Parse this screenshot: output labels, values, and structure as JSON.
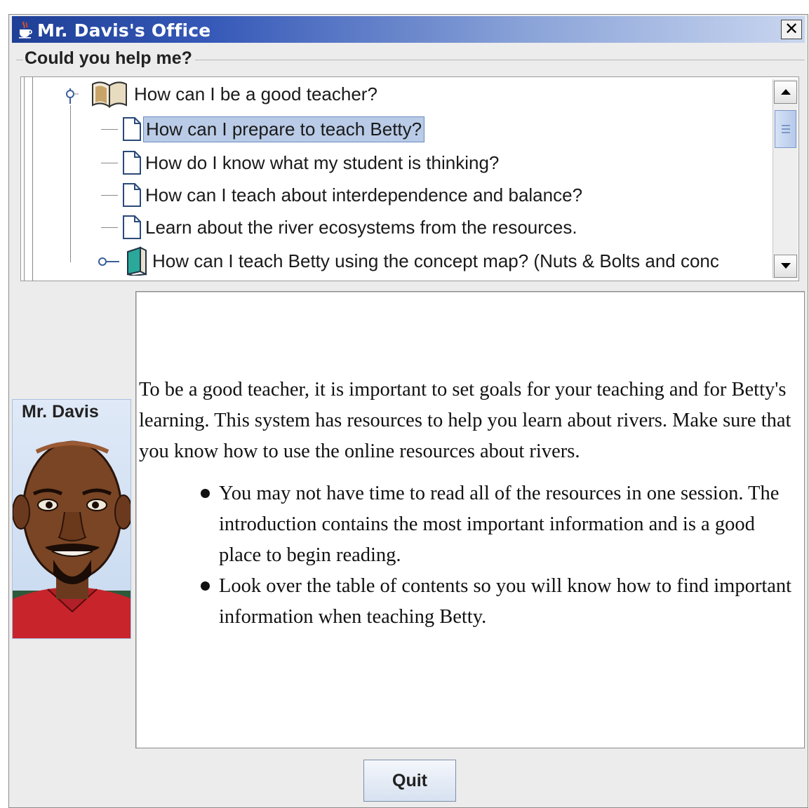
{
  "window": {
    "title": "Mr. Davis's Office",
    "close_label": "✕",
    "icon": "java-cup-icon"
  },
  "help_group": {
    "label": "Could you help me?"
  },
  "tree": {
    "parent": {
      "label": "How can I be a good teacher?",
      "icon": "open-book-icon",
      "expanded": true
    },
    "items": [
      {
        "label": "How can I prepare to teach Betty?",
        "icon": "document-icon",
        "selected": true
      },
      {
        "label": "How do I know what my student is thinking?",
        "icon": "document-icon"
      },
      {
        "label": "How can I teach about interdependence and balance?",
        "icon": "document-icon"
      },
      {
        "label": "Learn about the river ecosystems from the resources.",
        "icon": "document-icon"
      },
      {
        "label": "How can I teach Betty using the concept map? (Nuts & Bolts and conc",
        "icon": "closed-book-icon",
        "collapsed": true
      }
    ]
  },
  "agent": {
    "name": "Mr. Davis",
    "avatar": "teacher-avatar"
  },
  "content": {
    "paragraph": "To be a good teacher, it is important to set goals for your teaching and for Betty's learning.  This system has resources to help you learn about rivers. Make sure that you know how to use the online resources about rivers.",
    "bullets": [
      "You may not have time to read all of the resources in one session.  The introduction contains the most important information and is a good place to begin reading.",
      "Look over the table of contents so you will know how to find important information when teaching Betty."
    ]
  },
  "footer": {
    "quit_label": "Quit"
  },
  "colors": {
    "titlebar_start": "#1f3f96",
    "selection": "#b9cbe6",
    "window_bg": "#ececec"
  }
}
